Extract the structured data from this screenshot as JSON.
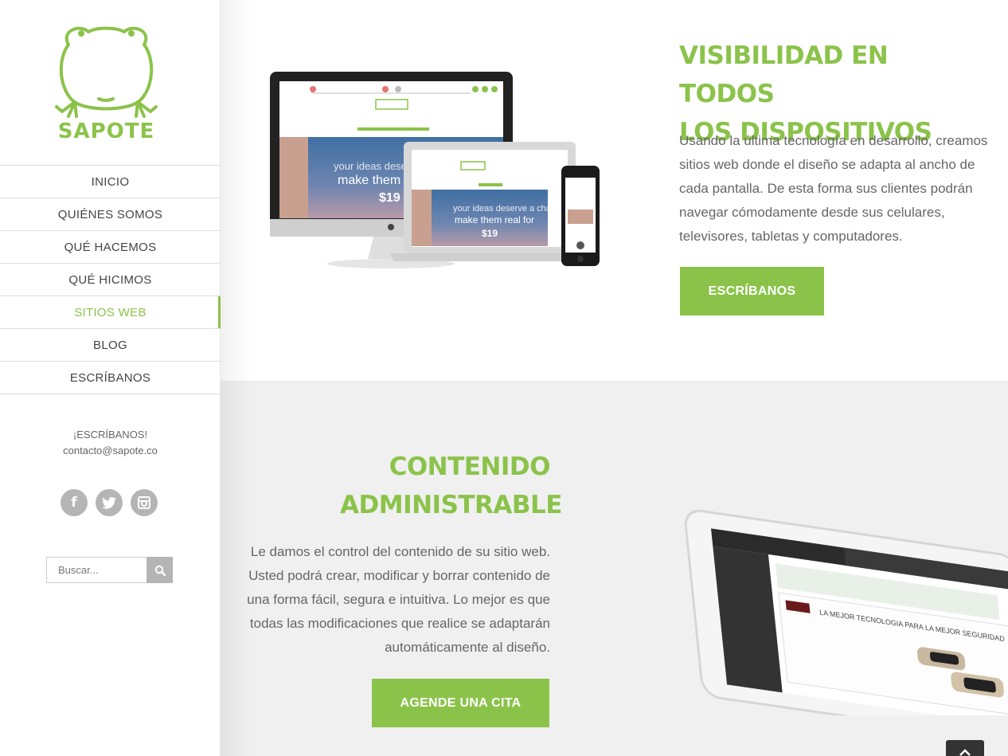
{
  "brand": {
    "name": "SAPOTE",
    "accent": "#8bc34a"
  },
  "nav": {
    "items": [
      {
        "label": "INICIO",
        "active": false
      },
      {
        "label": "QUIÉNES SOMOS",
        "active": false
      },
      {
        "label": "QUÉ HACEMOS",
        "active": false
      },
      {
        "label": "QUÉ HICIMOS",
        "active": false
      },
      {
        "label": "SITIOS WEB",
        "active": true
      },
      {
        "label": "BLOG",
        "active": false
      },
      {
        "label": "ESCRÍBANOS",
        "active": false
      }
    ]
  },
  "contact": {
    "title": "¡ESCRÍBANOS!",
    "email": "contacto@sapote.co"
  },
  "social": {
    "icons": [
      "facebook-icon",
      "twitter-icon",
      "instagram-icon"
    ]
  },
  "search": {
    "placeholder": "Buscar..."
  },
  "section1": {
    "title_line1": "VISIBILIDAD EN TODOS",
    "title_line2": "LOS DISPOSITIVOS",
    "body": "Usando la última tecnología en desarrollo, creamos sitios web donde el diseño se adapta al ancho de cada pantalla. De esta forma sus clientes podrán navegar cómodamente desde sus celulares, televisores, tabletas y computadores.",
    "button": "ESCRÍBANOS"
  },
  "section2": {
    "title_line1": "CONTENIDO",
    "title_line2": "ADMINISTRABLE",
    "body": "Le damos el control del contenido de su sitio web. Usted podrá crear, modificar y borrar contenido de una forma fácil, segura e intuitiva. Lo mejor es que todas las modificaciones que realice se adaptarán automáticamente al diseño.",
    "button": "AGENDE UNA CITA"
  },
  "mockup": {
    "screen_line1": "your ideas deserve a chance",
    "screen_line2": "make them real for",
    "price": "$19",
    "tablet_headline": "LA MEJOR TECNOLOGIA PARA LA MEJOR SEGURIDAD"
  }
}
